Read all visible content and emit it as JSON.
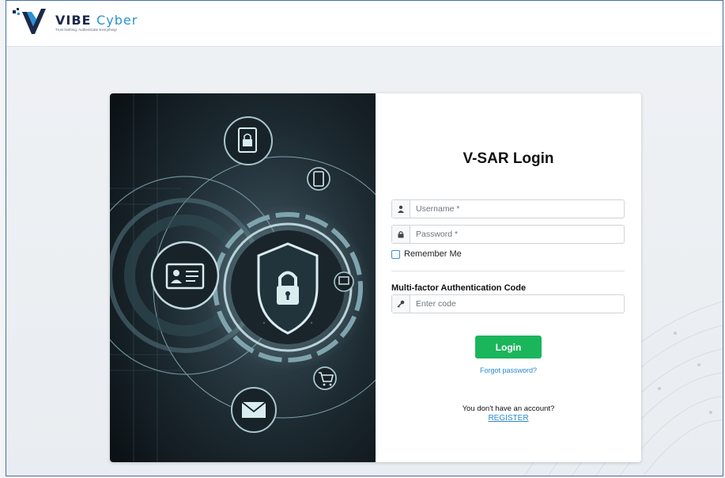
{
  "header": {
    "logo_word_1": "VIBE",
    "logo_word_2": "Cyber",
    "logo_tagline": "Trust Nothing. Authenticate Everything!"
  },
  "login": {
    "title": "V-SAR Login",
    "username": {
      "placeholder": "Username *",
      "value": "",
      "icon": "user-icon"
    },
    "password": {
      "placeholder": "Password *",
      "value": "",
      "icon": "lock-icon"
    },
    "remember_label": "Remember Me",
    "remember_checked": false,
    "mfa_label": "Multi-factor Authentication Code",
    "mfa": {
      "placeholder": "Enter code",
      "value": "",
      "icon": "key-icon"
    },
    "login_button": "Login",
    "forgot_link": "Forgot password?",
    "no_account_text": "You don't have an account?",
    "register_link": "REGISTER"
  },
  "colors": {
    "accent_green": "#1bb55c",
    "link_blue": "#2b8ad3",
    "brand_navy": "#1b2a4a",
    "brand_blue": "#2a93d5"
  }
}
